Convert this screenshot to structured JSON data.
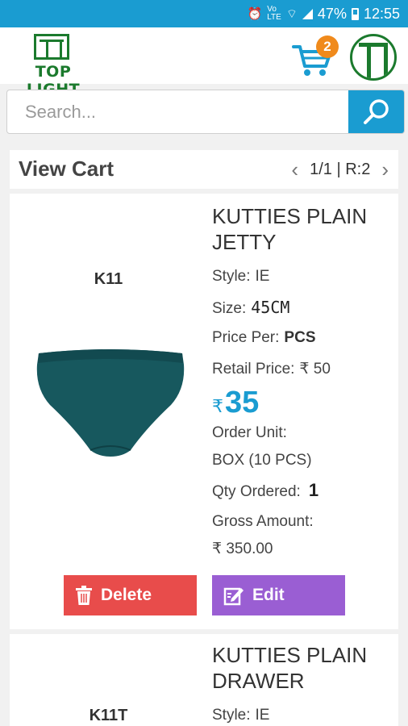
{
  "status_bar": {
    "battery": "47%",
    "time": "12:55"
  },
  "header": {
    "logo_text": "TOP LIGHT",
    "cart_count": "2"
  },
  "search": {
    "placeholder": "Search..."
  },
  "cart": {
    "title": "View Cart",
    "pager": "1/1 | R:2"
  },
  "items": [
    {
      "code": "K11",
      "name": "KUTTIES PLAIN JETTY",
      "style_label": "Style:",
      "style_value": "IE",
      "size_label": "Size:",
      "size_value": "45CM",
      "price_per_label": "Price Per:",
      "price_per_value": "PCS",
      "retail_label": "Retail Price:",
      "retail_value": "₹ 50",
      "currency": "₹",
      "price": "35",
      "order_unit_label": "Order Unit:",
      "order_unit_value": "BOX (10 PCS)",
      "qty_label": "Qty Ordered:",
      "qty_value": "1",
      "gross_label": "Gross Amount:",
      "gross_value": "₹ 350.00",
      "delete_label": "Delete",
      "edit_label": "Edit"
    },
    {
      "code": "K11T",
      "name": "KUTTIES PLAIN DRAWER",
      "style_label": "Style:",
      "style_value": "IE"
    }
  ],
  "colors": {
    "primary": "#1a9cd1",
    "brand_green": "#1b7a2d",
    "badge": "#f08a1c",
    "delete": "#e84c4b",
    "edit": "#9a5ed3"
  }
}
